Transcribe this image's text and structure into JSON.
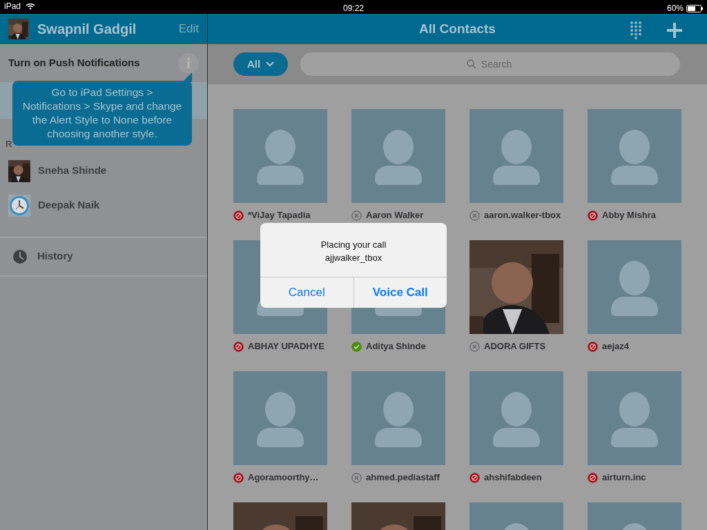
{
  "status_bar": {
    "device": "iPad",
    "time": "09:22",
    "battery": "60%"
  },
  "sidebar": {
    "profile": {
      "name": "Swapnil Gadgil",
      "action": "Edit"
    },
    "notice": {
      "title": "Turn on Push Notifications",
      "tooltip": "Go to iPad Settings > Notifications > Skype and change the Alert Style to None before choosing another style."
    },
    "section_label": "R",
    "recent": [
      {
        "name": "Sneha Shinde",
        "kind": "picture"
      },
      {
        "name": "Deepak Naik",
        "kind": "clock"
      }
    ],
    "menu": [
      {
        "label": "History"
      }
    ]
  },
  "header": {
    "title": "All Contacts"
  },
  "filter": {
    "label": "All"
  },
  "search": {
    "placeholder": "Search"
  },
  "contacts": [
    {
      "name": "*ViJay Tapadia",
      "status_icon": {
        "kind": "blocked"
      },
      "kind": "placeholder"
    },
    {
      "name": "Aaron Walker",
      "status_icon": {
        "kind": "offline"
      },
      "kind": "placeholder"
    },
    {
      "name": "aaron.walker-tbox",
      "status_icon": {
        "kind": "offline"
      },
      "kind": "placeholder"
    },
    {
      "name": "Abby Mishra",
      "status_icon": {
        "kind": "blocked"
      },
      "kind": "placeholder"
    },
    {
      "name": "ABHAY UPADHYE",
      "status_icon": {
        "kind": "blocked"
      },
      "kind": "placeholder"
    },
    {
      "name": "Aditya Shinde",
      "status_icon": {
        "kind": "online"
      },
      "kind": "placeholder"
    },
    {
      "name": "ADORA GIFTS",
      "status_icon": {
        "kind": "offline"
      },
      "kind": "picture"
    },
    {
      "name": "aejaz4",
      "status_icon": {
        "kind": "blocked"
      },
      "kind": "placeholder"
    },
    {
      "name": "Agoramoorthy…",
      "status_icon": {
        "kind": "blocked"
      },
      "kind": "placeholder"
    },
    {
      "name": "ahmed.pediastaff",
      "status_icon": {
        "kind": "offline"
      },
      "kind": "placeholder"
    },
    {
      "name": "ahshifabdeen",
      "status_icon": {
        "kind": "blocked"
      },
      "kind": "placeholder"
    },
    {
      "name": "airturn.inc",
      "status_icon": {
        "kind": "blocked"
      },
      "kind": "placeholder"
    },
    {
      "kind": "picture"
    },
    {
      "kind": "picture"
    },
    {
      "kind": "placeholder"
    },
    {
      "kind": "placeholder"
    }
  ],
  "dialog": {
    "title": "Placing your call",
    "subtitle": "ajjwalker_tbox",
    "buttons": [
      {
        "label": "Cancel",
        "primary": false
      },
      {
        "label": "Voice Call",
        "primary": true
      }
    ]
  }
}
